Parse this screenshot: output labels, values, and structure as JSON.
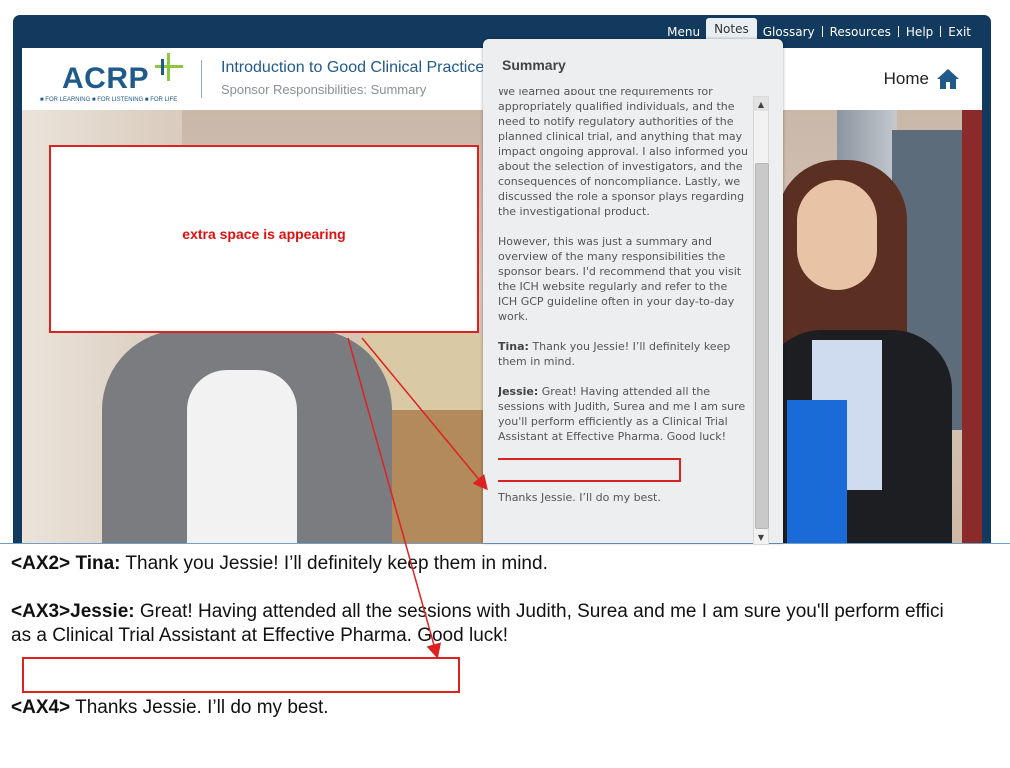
{
  "player": {
    "nav": [
      "Menu",
      "Notes",
      "Glossary",
      "Resources",
      "Help",
      "Exit"
    ],
    "active_nav": "Notes",
    "logo_text": "ACRP",
    "logo_tagline": "■ FOR LEARNING ■ FOR LISTENING ■ FOR LIFE",
    "course_title": "Introduction to Good Clinical Practice",
    "course_subtitle": "Sponsor Responsibilities: Summary",
    "home_label": "Home"
  },
  "notes": {
    "title": "Summary",
    "paragraph1": "We learned about the requirements for appropriately qualified individuals, and the need to notify regulatory authorities of the planned clinical trial, and anything that may impact ongoing approval. I also informed you about the selection of investigators, and the consequences of noncompliance. Lastly, we discussed the role a sponsor plays regarding the investigational product.",
    "paragraph2": "However, this was just a summary and overview of the many responsibilities the sponsor bears. I'd recommend that you visit the ICH website regularly and refer to the ICH GCP guideline often in your day-to-day work.",
    "tina_name": "Tina:",
    "tina_text": "Thank you Jessie! I’ll definitely keep them in mind.",
    "jessie_name": "Jessie:",
    "jessie_text": "Great! Having attended all the sessions with Judith, Surea and me I am sure you'll perform efficiently as a Clinical Trial Assistant at Effective Pharma. Good luck!",
    "last_line": "Thanks Jessie. I’ll do my best."
  },
  "annotation": {
    "callout_text": "extra space is appearing",
    "color": "#dd2222"
  },
  "transcript": {
    "line1_tag": "<AX2>",
    "line1_name": "Tina:",
    "line1_text": "Thank you Jessie! I’ll definitely keep them in mind.",
    "line2_tag": "<AX3>",
    "line2_name": "Jessie:",
    "line2_text": "Great! Having attended all the sessions with Judith, Surea and me I am sure you'll perform effici",
    "line2_cont": "as a Clinical Trial Assistant at Effective Pharma. Good luck!",
    "line3_tag": "<AX4>",
    "line3_text": "Thanks Jessie. I’ll do my best."
  },
  "colors": {
    "frame": "#123a5e",
    "brand": "#1f5a8b",
    "annotation": "#dd2222"
  }
}
